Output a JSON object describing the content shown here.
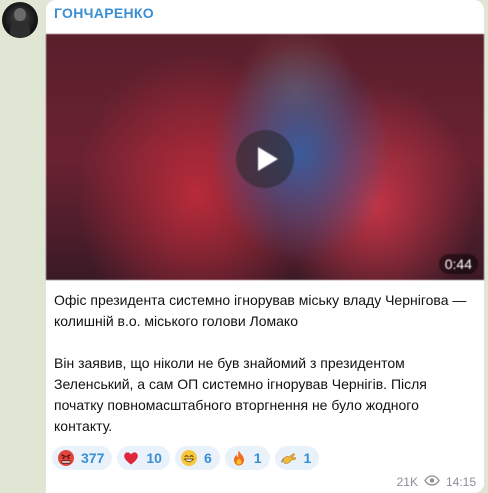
{
  "channel": {
    "sender_name": "ГОНЧАРЕНКО"
  },
  "video": {
    "duration": "0:44",
    "play_icon": "play-icon"
  },
  "message": {
    "paragraph_1": "Офіс президента системно ігнорував міську владу Чернігова — колишній в.о. міського голови Ломако",
    "paragraph_2": "Він заявив, що ніколи не був знайомий з президентом Зеленський, а сам ОП системно ігнорував Чернігів. Після початку повномасштабного вторгнення не було жодного контакту."
  },
  "reactions": [
    {
      "icon": "angry-face-icon",
      "count": "377"
    },
    {
      "icon": "heart-icon",
      "count": "10"
    },
    {
      "icon": "grin-face-icon",
      "count": "6"
    },
    {
      "icon": "fire-icon",
      "count": "1"
    },
    {
      "icon": "hand-icon",
      "count": "1"
    }
  ],
  "meta": {
    "views": "21K",
    "time": "14:15"
  },
  "colors": {
    "background": "#dfe7d4",
    "accent": "#3a8fd4",
    "reaction_bg": "#e9f1fb"
  }
}
